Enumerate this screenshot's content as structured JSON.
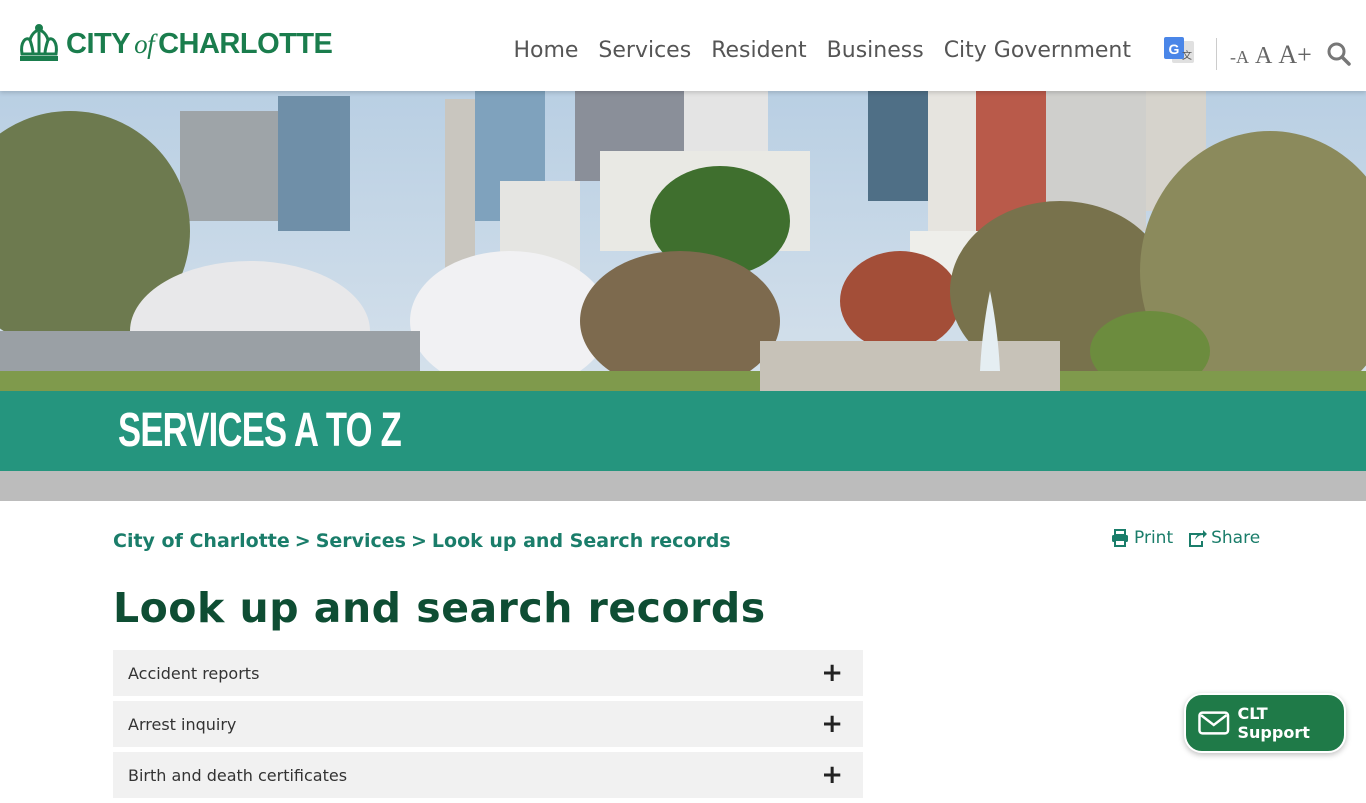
{
  "header": {
    "logo": {
      "city": "CITY",
      "of": "of",
      "name": "CHARLOTTE"
    },
    "nav": [
      "Home",
      "Services",
      "Resident",
      "Business",
      "City Government"
    ],
    "font_sizer": {
      "small": "-A",
      "normal": "A",
      "large": "A+"
    }
  },
  "hero": {
    "title": "SERVICES A TO Z"
  },
  "breadcrumb": {
    "items": [
      "City of Charlotte",
      "Services",
      "Look up and Search records"
    ],
    "separator": ">"
  },
  "tools": {
    "print": "Print",
    "share": "Share"
  },
  "page_title": "Look up and search records",
  "accordion": {
    "items": [
      {
        "label": "Accident reports"
      },
      {
        "label": "Arrest inquiry"
      },
      {
        "label": "Birth and death certificates"
      }
    ]
  },
  "support": {
    "label": "CLT Support"
  },
  "colors": {
    "brand_green": "#1a7d4d",
    "teal_band": "#1c967d",
    "dark_green": "#0e4d33",
    "support_green": "#1f7a48"
  }
}
